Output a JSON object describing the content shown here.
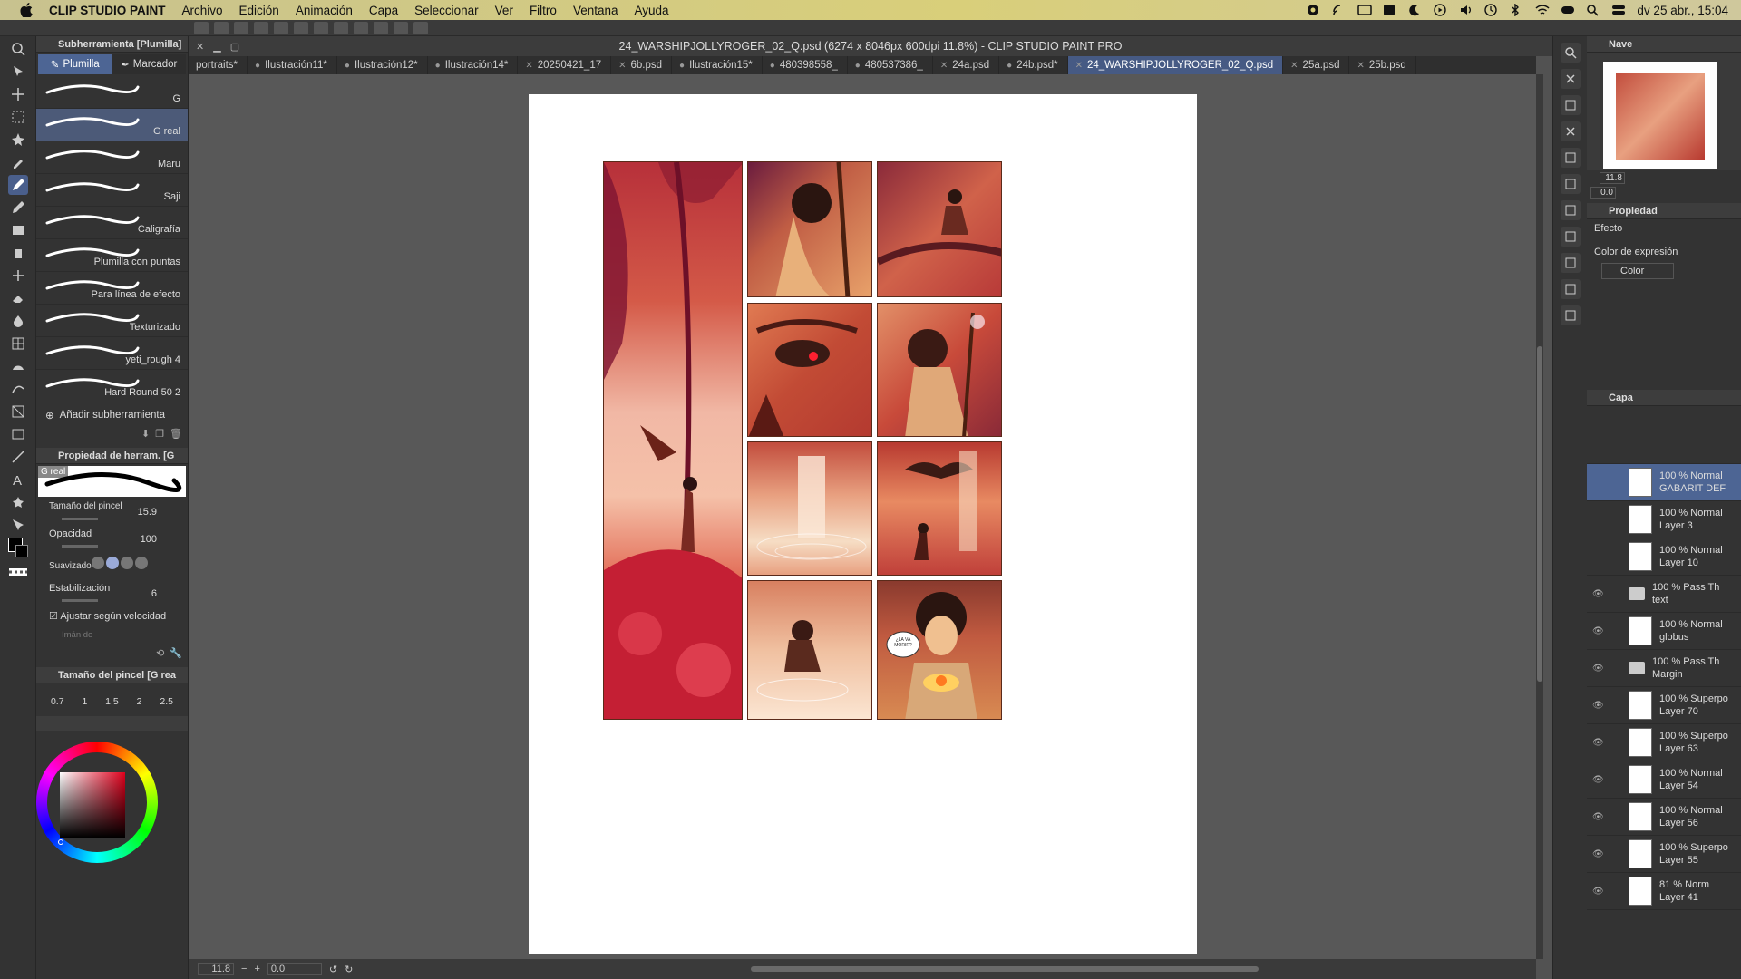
{
  "menubar": {
    "app_name": "CLIP STUDIO PAINT",
    "items": [
      "Archivo",
      "Edición",
      "Animación",
      "Capa",
      "Seleccionar",
      "Ver",
      "Filtro",
      "Ventana",
      "Ayuda"
    ],
    "datetime": "dv 25 abr., 15:04"
  },
  "window": {
    "title": "24_WARSHIPJOLLYROGER_02_Q.psd (6274 x 8046px 600dpi 11.8%) - CLIP STUDIO PAINT PRO"
  },
  "tabs": [
    {
      "label": "portraits*",
      "active": false
    },
    {
      "label": "Ilustración11*",
      "active": false
    },
    {
      "label": "Ilustración12*",
      "active": false
    },
    {
      "label": "Ilustración14*",
      "active": false
    },
    {
      "label": "20250421_17",
      "active": false
    },
    {
      "label": "6b.psd",
      "active": false
    },
    {
      "label": "Ilustración15*",
      "active": false
    },
    {
      "label": "480398558_",
      "active": false
    },
    {
      "label": "480537386_",
      "active": false
    },
    {
      "label": "24a.psd",
      "active": false
    },
    {
      "label": "24b.psd*",
      "active": false
    },
    {
      "label": "24_WARSHIPJOLLYROGER_02_Q.psd",
      "active": true
    },
    {
      "label": "25a.psd",
      "active": false
    },
    {
      "label": "25b.psd",
      "active": false
    }
  ],
  "subtool": {
    "header": "Subherramienta [Plumilla]",
    "tab_plumilla": "Plumilla",
    "tab_marcador": "Marcador",
    "brushes": [
      {
        "name": "G",
        "selected": false
      },
      {
        "name": "G real",
        "selected": true
      },
      {
        "name": "Maru",
        "selected": false
      },
      {
        "name": "Saji",
        "selected": false
      },
      {
        "name": "Caligrafía",
        "selected": false
      },
      {
        "name": "Plumilla con puntas",
        "selected": false
      },
      {
        "name": "Para línea de efecto",
        "selected": false
      },
      {
        "name": "Texturizado",
        "selected": false
      },
      {
        "name": "yeti_rough 4",
        "selected": false
      },
      {
        "name": "Hard Round 50 2",
        "selected": false
      }
    ],
    "add_label": "Añadir subherramienta"
  },
  "toolprop": {
    "header": "Propiedad de herram. [G",
    "preview_label": "G real",
    "brush_size_label": "Tamaño del pincel",
    "brush_size": "15.9",
    "opacity_label": "Opacidad",
    "opacity": "100",
    "smoothing_label": "Suavizado",
    "stabilization_label": "Estabilización",
    "stabilization": "6",
    "velocity_label": "Ajustar según velocidad",
    "magnet_label": "Imán de"
  },
  "brushsize": {
    "header": "Tamaño del pincel [G rea",
    "sizes": [
      "0.7",
      "1",
      "1.5",
      "2",
      "2.5"
    ]
  },
  "canvas": {
    "zoom": "11.8",
    "rotation": "0.0"
  },
  "navigator": {
    "header": "Nave",
    "zoom": "11.8",
    "rotation": "0.0"
  },
  "properties": {
    "header": "Propiedad",
    "effect_label": "Efecto",
    "expression_label": "Color de expresión",
    "expression_value": "Color"
  },
  "layers": {
    "header": "Capa",
    "items": [
      {
        "mode": "100 % Normal",
        "name": "GABARIT DEF",
        "selected": true,
        "folder": false
      },
      {
        "mode": "100 % Normal",
        "name": "Layer 3",
        "selected": false,
        "folder": false
      },
      {
        "mode": "100 % Normal",
        "name": "Layer 10",
        "selected": false,
        "folder": false
      },
      {
        "mode": "100 % Pass Th",
        "name": "text",
        "selected": false,
        "folder": true
      },
      {
        "mode": "100 % Normal",
        "name": "globus",
        "selected": false,
        "folder": false
      },
      {
        "mode": "100 % Pass Th",
        "name": "Margin",
        "selected": false,
        "folder": true
      },
      {
        "mode": "100 % Superpo",
        "name": "Layer 70",
        "selected": false,
        "folder": false
      },
      {
        "mode": "100 % Superpo",
        "name": "Layer 63",
        "selected": false,
        "folder": false
      },
      {
        "mode": "100 % Normal",
        "name": "Layer 54",
        "selected": false,
        "folder": false
      },
      {
        "mode": "100 % Normal",
        "name": "Layer 56",
        "selected": false,
        "folder": false
      },
      {
        "mode": "100 % Superpo",
        "name": "Layer 55",
        "selected": false,
        "folder": false
      },
      {
        "mode": "81 % Norm",
        "name": "Layer 41",
        "selected": false,
        "folder": false
      }
    ]
  },
  "comic": {
    "speech_bubble": "¿LA VA MORIR?"
  }
}
